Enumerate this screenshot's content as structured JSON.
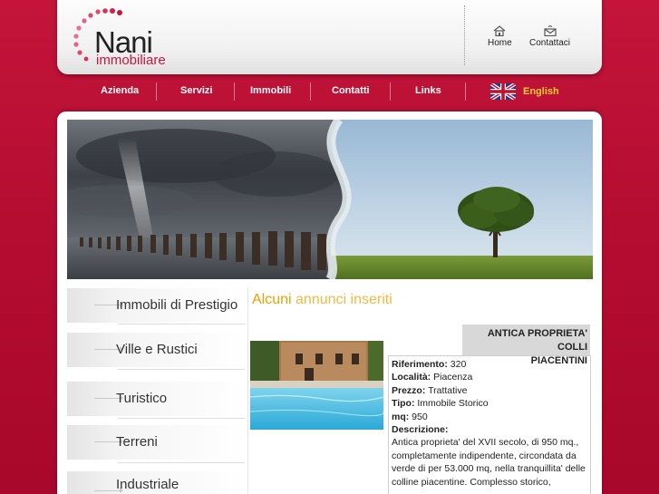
{
  "brand": {
    "name": "Nani",
    "subtitle": "immobiliare"
  },
  "top_links": [
    {
      "label": "Home",
      "icon": "home-icon"
    },
    {
      "label": "Contattaci",
      "icon": "mail-icon"
    }
  ],
  "nav": {
    "items": [
      "Azienda",
      "Servizi",
      "Immobili",
      "Contatti",
      "Links"
    ],
    "language": "English",
    "language_icon": "uk-flag-icon"
  },
  "sidebar": {
    "items": [
      {
        "label": "Immobili di Prestigio"
      },
      {
        "label": "Ville e Rustici"
      },
      {
        "label": "Turistico"
      },
      {
        "label": "Terreni"
      },
      {
        "label": "Industriale"
      }
    ]
  },
  "content": {
    "title_bold": "Alcuni",
    "title_light": "annunci inseriti"
  },
  "listing": {
    "heading_line1": "ANTICA PROPRIETA' COLLI",
    "heading_line2": "PIACENTINI",
    "riferimento_label": "Riferimento:",
    "riferimento": "320",
    "localita_label": "Località:",
    "localita": "Piacenza",
    "prezzo_label": "Prezzo:",
    "prezzo": "Trattative",
    "tipo_label": "Tipo:",
    "tipo": "Immobile Storico",
    "mq_label": "mq:",
    "mq": "950",
    "descrizione_label": "Descrizione:",
    "descrizione": "Antica proprieta' del XVII secolo, di 950 mq., completamente indipendente, circondata da verde di per 53.000 mq, nella tranquillita' delle colline piacentine. Complesso storico,"
  },
  "colors": {
    "background": "#b50d31",
    "accent_orange": "#f0a000",
    "english_yellow": "#ffcc33",
    "brand_red": "#c8163d"
  }
}
